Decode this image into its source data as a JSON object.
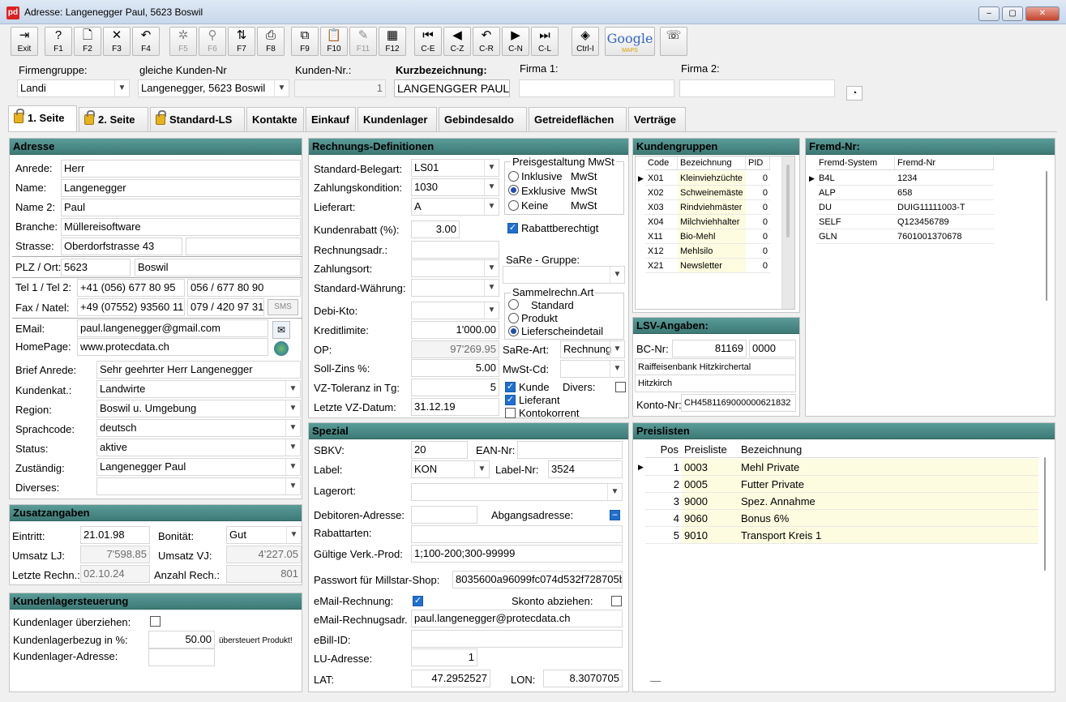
{
  "window": {
    "title": "Adresse: Langenegger Paul, 5623 Boswil",
    "app_icon": "pd",
    "controls": [
      "–",
      "▢",
      "✕"
    ]
  },
  "toolbar": [
    {
      "name": "exit",
      "label": "Exit",
      "icon": "⇥",
      "enabled": true
    },
    {
      "name": "f1",
      "label": "F1",
      "icon": "?",
      "enabled": true
    },
    {
      "name": "f2",
      "label": "F2",
      "icon": "🗋",
      "enabled": true
    },
    {
      "name": "f3",
      "label": "F3",
      "icon": "✕",
      "enabled": true
    },
    {
      "name": "f4",
      "label": "F4",
      "icon": "↶",
      "enabled": true
    },
    {
      "name": "f5",
      "label": "F5",
      "icon": "✲",
      "enabled": false
    },
    {
      "name": "f6",
      "label": "F6",
      "icon": "⚲",
      "enabled": false
    },
    {
      "name": "f7",
      "label": "F7",
      "icon": "⇅",
      "enabled": true
    },
    {
      "name": "f8",
      "label": "F8",
      "icon": "⎙",
      "enabled": true
    },
    {
      "name": "f9",
      "label": "F9",
      "icon": "⧉",
      "enabled": true
    },
    {
      "name": "f10",
      "label": "F10",
      "icon": "📋",
      "enabled": true
    },
    {
      "name": "f11",
      "label": "F11",
      "icon": "✎",
      "enabled": false
    },
    {
      "name": "f12",
      "label": "F12",
      "icon": "▦",
      "enabled": true
    },
    {
      "name": "c-e",
      "label": "C-E",
      "icon": "⏮",
      "enabled": true
    },
    {
      "name": "c-z",
      "label": "C-Z",
      "icon": "◀",
      "enabled": true
    },
    {
      "name": "c-r",
      "label": "C-R",
      "icon": "↶",
      "enabled": true
    },
    {
      "name": "c-n",
      "label": "C-N",
      "icon": "▶",
      "enabled": true
    },
    {
      "name": "c-l",
      "label": "C-L",
      "icon": "⏭",
      "enabled": true
    },
    {
      "name": "ctrl-i",
      "label": "Ctrl-I",
      "icon": "◈",
      "enabled": true
    },
    {
      "name": "google-maps",
      "label": "Google",
      "sublabel": "MAPS",
      "icon": "",
      "enabled": true
    },
    {
      "name": "phone",
      "label": "",
      "icon": "☏",
      "enabled": true
    }
  ],
  "header": {
    "firmengruppe_label": "Firmengruppe:",
    "firmengruppe": "Landi",
    "gleiche_label": "gleiche Kunden-Nr",
    "gleiche": "Langenegger, 5623 Boswil",
    "kunden_nr_label": "Kunden-Nr.:",
    "kunden_nr": "1",
    "kurz_label": "Kurzbezeichnung:",
    "kurz": "LANGENGGER PAUL",
    "firma1_label": "Firma 1:",
    "firma1": "",
    "firma2_label": "Firma 2:",
    "firma2": ""
  },
  "tabs": [
    {
      "label": "1. Seite",
      "lock": true,
      "active": true
    },
    {
      "label": "2. Seite",
      "lock": true
    },
    {
      "label": "Standard-LS",
      "lock": true
    },
    {
      "label": "Kontakte"
    },
    {
      "label": "Einkauf"
    },
    {
      "label": "Kundenlager"
    },
    {
      "label": "Gebindesaldo"
    },
    {
      "label": "Getreideflächen"
    },
    {
      "label": "Verträge"
    }
  ],
  "adresse": {
    "title": "Adresse",
    "anrede_label": "Anrede:",
    "anrede": "Herr",
    "name_label": "Name:",
    "name": "Langenegger",
    "name2_label": "Name 2:",
    "name2": "Paul",
    "branche_label": "Branche:",
    "branche": "Müllereisoftware",
    "strasse_label": "Strasse:",
    "strasse": "Oberdorfstrasse 43",
    "plz_label": "PLZ / Ort:",
    "plz": "5623",
    "ort": "Boswil",
    "tel_label": "Tel 1 / Tel 2:",
    "tel1": "+41 (056) 677 80 95",
    "tel2": "056 / 677 80 90",
    "fax_label": "Fax / Natel:",
    "fax": "+49 (07552) 93560 11",
    "natel": "079 / 420 97 31",
    "sms": "SMS",
    "email_label": "EMail:",
    "email": "paul.langenegger@gmail.com",
    "homepage_label": "HomePage:",
    "homepage": "www.protecdata.ch",
    "brief_label": "Brief Anrede:",
    "brief": "Sehr geehrter Herr Langenegger",
    "kundenkat_label": "Kundenkat.:",
    "kundenkat": "Landwirte",
    "region_label": "Region:",
    "region": "Boswil u. Umgebung",
    "sprache_label": "Sprachcode:",
    "sprache": "deutsch",
    "status_label": "Status:",
    "status": "aktive",
    "zustaendig_label": "Zuständig:",
    "zustaendig": "Langenegger Paul",
    "diverses_label": "Diverses:",
    "diverses": ""
  },
  "zusatz": {
    "title": "Zusatzangaben",
    "eintritt_label": "Eintritt:",
    "eintritt": "21.01.98",
    "bonitaet_label": "Bonität:",
    "bonitaet": "Gut",
    "umsatz_lj_label": "Umsatz LJ:",
    "umsatz_lj": "7'598.85",
    "umsatz_vj_label": "Umsatz VJ:",
    "umsatz_vj": "4'227.05",
    "letzte_label": "Letzte Rechn.:",
    "letzte": "02.10.24",
    "anzahl_label": "Anzahl Rech.:",
    "anzahl": "801"
  },
  "lager": {
    "title": "Kundenlagersteuerung",
    "ueberziehen_label": "Kundenlager überziehen:",
    "ueberziehen": false,
    "bezug_label": "Kundenlagerbezug in %:",
    "bezug": "50.00",
    "bezug_note": "übersteuert Produkt!",
    "adresse_label": "Kundenlager-Adresse:",
    "adresse": ""
  },
  "rechnung": {
    "title": "Rechnungs-Definitionen",
    "belegart_label": "Standard-Belegart:",
    "belegart": "LS01",
    "zahlungskond_label": "Zahlungskondition:",
    "zahlungskond": "1030",
    "lieferart_label": "Lieferart:",
    "lieferart": "A",
    "rabatt_label": "Kundenrabatt (%):",
    "rabatt": "3.00",
    "rechnungsadr_label": "Rechnungsadr.:",
    "zahlungsort_label": "Zahlungsort:",
    "waehrung_label": "Standard-Währung:",
    "debi_label": "Debi-Kto:",
    "kreditlimite_label": "Kreditlimite:",
    "kreditlimite": "1'000.00",
    "op_label": "OP:",
    "op": "97'269.95",
    "sollzins_label": "Soll-Zins %:",
    "sollzins": "5.00",
    "vz_label": "VZ-Toleranz in Tg:",
    "vz": "5",
    "letzte_vz_label": "Letzte VZ-Datum:",
    "letzte_vz": "31.12.19",
    "preis_title": "Preisgestaltung MwSt",
    "preis_options": [
      "Inklusive",
      "Exklusive",
      "Keine"
    ],
    "preis_mwst": "MwSt",
    "preis_selected": 1,
    "rabattberechtigt_label": "Rabattberechtigt",
    "rabattberechtigt": true,
    "sare_gruppe_label": "SaRe - Gruppe:",
    "sammel_title": "Sammelrechn.Art",
    "sammel_options": [
      "Standard",
      "Produkt",
      "Lieferscheindetail"
    ],
    "sammel_selected": 2,
    "sare_art_label": "SaRe-Art:",
    "sare_art": "Rechnung",
    "mwst_cd_label": "MwSt-Cd:",
    "kunde_label": "Kunde",
    "kunde": true,
    "divers_label": "Divers:",
    "divers": false,
    "lieferant_label": "Lieferant",
    "lieferant": true,
    "kontokorrent_label": "Kontokorrent",
    "kontokorrent": false
  },
  "spezial": {
    "title": "Spezial",
    "sbkv_label": "SBKV:",
    "sbkv": "20",
    "ean_label": "EAN-Nr:",
    "label_label": "Label:",
    "label": "KON",
    "labelnr_label": "Label-Nr:",
    "labelnr": "3524",
    "lagerort_label": "Lagerort:",
    "debitoren_label": "Debitoren-Adresse:",
    "abgang_label": "Abgangsadresse:",
    "rabattarten_label": "Rabattarten:",
    "verk_label": "Gültige Verk.-Prod:",
    "verk": "1;100-200;300-99999",
    "passwort_label": "Passwort für Millstar-Shop:",
    "passwort": "8035600a96099fc074d532f728705b",
    "email_rechnung_label": "eMail-Rechnung:",
    "email_rechnung": true,
    "skonto_label": "Skonto abziehen:",
    "skonto": false,
    "email_adr_label": "eMail-Rechnugsadr.",
    "email_adr": "paul.langenegger@protecdata.ch",
    "ebill_label": "eBill-ID:",
    "lu_label": "LU-Adresse:",
    "lu": "1",
    "lat_label": "LAT:",
    "lat": "47.2952527",
    "lon_label": "LON:",
    "lon": "8.3070705"
  },
  "kundengruppen": {
    "title": "Kundengruppen",
    "columns": [
      "Code",
      "Bezeichnung",
      "PID"
    ],
    "rows": [
      [
        "X01",
        "Kleinviehzüchte",
        "0"
      ],
      [
        "X02",
        "Schweinemäste",
        "0"
      ],
      [
        "X03",
        "Rindviehmäster",
        "0"
      ],
      [
        "X04",
        "Milchviehhalter",
        "0"
      ],
      [
        "X11",
        "Bio-Mehl",
        "0"
      ],
      [
        "X12",
        "Mehlsilo",
        "0"
      ],
      [
        "X21",
        "Newsletter",
        "0"
      ]
    ]
  },
  "fremd": {
    "title": "Fremd-Nr:",
    "columns": [
      "Fremd-System",
      "Fremd-Nr"
    ],
    "rows": [
      [
        "B4L",
        "1234"
      ],
      [
        "ALP",
        "658"
      ],
      [
        "DU",
        "DUIG11111003-T"
      ],
      [
        "SELF",
        "Q123456789"
      ],
      [
        "GLN",
        "7601001370678"
      ]
    ]
  },
  "lsv": {
    "title": "LSV-Angaben:",
    "bc_label": "BC-Nr:",
    "bc": "81169",
    "bc2": "0000",
    "bank": "Raiffeisenbank Hitzkirchertal",
    "ort": "Hitzkirch",
    "konto_label": "Konto-Nr:",
    "konto": "CH4581169000000621832"
  },
  "preislisten": {
    "title": "Preislisten",
    "columns": [
      "Pos",
      "Preisliste",
      "Bezeichnung"
    ],
    "rows": [
      [
        "1",
        "0003",
        "Mehl Private"
      ],
      [
        "2",
        "0005",
        "Futter Private"
      ],
      [
        "3",
        "9000",
        "Spez. Annahme"
      ],
      [
        "4",
        "9060",
        "Bonus 6%"
      ],
      [
        "5",
        "9010",
        "Transport Kreis 1"
      ]
    ],
    "footer": "—"
  }
}
